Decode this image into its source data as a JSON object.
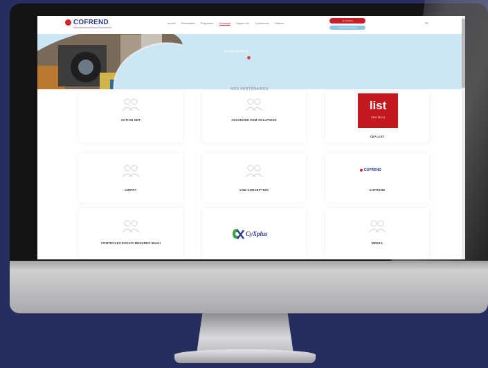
{
  "site": {
    "logo_text": "COFREND",
    "nav_items": [
      "Accueil",
      "Présentation",
      "Programme",
      "Exposants",
      "Espace Info",
      "Conférences",
      "Visiteurs"
    ],
    "active_nav": 3,
    "red_button": "Je m'inscris",
    "blue_button": "Réserver mon stand",
    "language": "FR"
  },
  "hero": {
    "title": "EXPOSANTS"
  },
  "partners": {
    "section_title": "NOS PARTENAIRES",
    "cards": [
      {
        "name": "ACTION NDT",
        "logo": "people-icon"
      },
      {
        "name": "ADVANCED OEM SOLUTIONS",
        "logo": "people-icon"
      },
      {
        "name": "CEA LIST",
        "logo": "list-logo",
        "logo_text": "list",
        "logo_subtext": "CEA TECH"
      },
      {
        "name": "CINPHY",
        "logo": "people-icon"
      },
      {
        "name": "CND CONCEPTION",
        "logo": "people-icon"
      },
      {
        "name": "COFREND",
        "logo": "cofrend-logo",
        "logo_text": "COFREND"
      },
      {
        "name": "CONTROLES ESSAIS MESURES IMAGI",
        "logo": "people-icon"
      },
      {
        "name": "",
        "logo": "cyxplus-logo",
        "logo_text": "CyXplus"
      },
      {
        "name": "DEKRA",
        "logo": "people-icon"
      }
    ]
  },
  "colors": {
    "background": "#262e5f",
    "brand_red": "#d2232a",
    "brand_blue": "#2b3a8f",
    "hero_bg": "#cce6f3"
  }
}
